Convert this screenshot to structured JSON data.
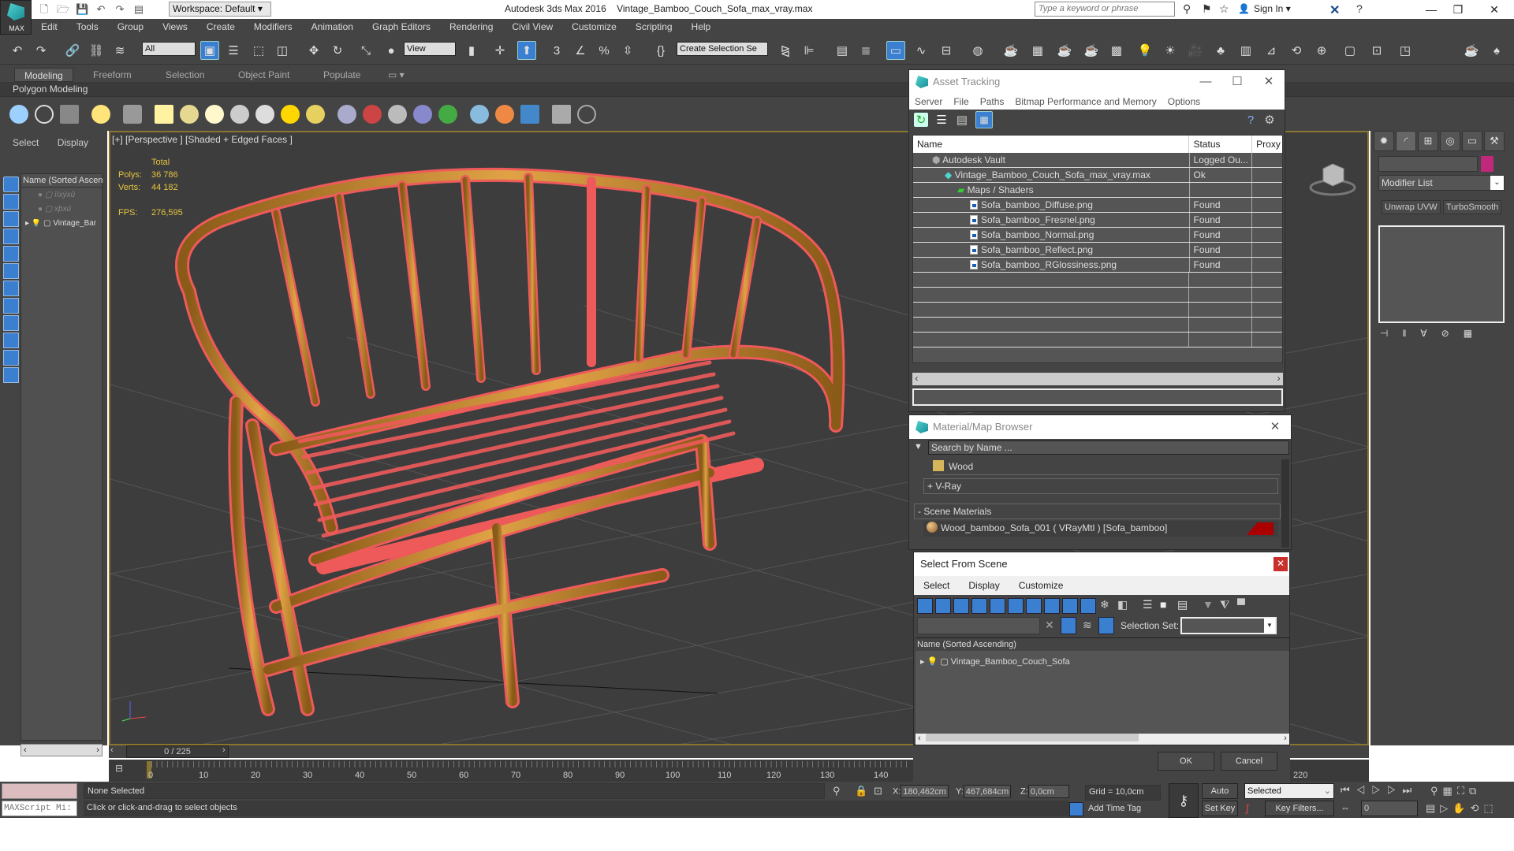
{
  "app": {
    "title": "Autodesk 3ds Max 2016",
    "filename": "Vintage_Bamboo_Couch_Sofa_max_vray.max",
    "logo_label": "MAX",
    "workspace": "Workspace: Default",
    "search_placeholder": "Type a keyword or phrase",
    "sign_in": "Sign In"
  },
  "menu": [
    "Edit",
    "Tools",
    "Group",
    "Views",
    "Create",
    "Modifiers",
    "Animation",
    "Graph Editors",
    "Rendering",
    "Civil View",
    "Customize",
    "Scripting",
    "Help"
  ],
  "toolbar": {
    "selection_filter": "All",
    "reference_coord": "View",
    "named_selection": "Create Selection Se"
  },
  "ribbon": {
    "tabs": [
      "Modeling",
      "Freeform",
      "Selection",
      "Object Paint",
      "Populate"
    ],
    "active_tab": "Modeling",
    "sub_label": "Polygon Modeling"
  },
  "scene_explorer": {
    "tabs": [
      "Select",
      "Display"
    ],
    "header": "Name (Sorted Ascending)",
    "rows": [
      "ïïxýxû",
      "xþxü",
      "Vintage_Bamboo_Couch_Sofa"
    ]
  },
  "viewport": {
    "label": "[+] [Perspective ] [Shaded + Edged Faces ]",
    "stats": {
      "total_label": "Total",
      "polys_label": "Polys:",
      "polys": "36 786",
      "verts_label": "Verts:",
      "verts": "44 182",
      "fps_label": "FPS:",
      "fps": "276,595"
    },
    "wire_color": "#ee5a5a",
    "object_color": "#c98a2e"
  },
  "command_panel": {
    "modifier_list": "Modifier List",
    "buttons": [
      "Unwrap UVW",
      "TurboSmooth"
    ],
    "object_color": "#c0287c"
  },
  "asset_tracking": {
    "title": "Asset Tracking",
    "menu": [
      "Server",
      "File",
      "Paths",
      "Bitmap Performance and Memory",
      "Options"
    ],
    "columns": [
      "Name",
      "Status",
      "Proxy S"
    ],
    "rows": [
      {
        "name": "Autodesk Vault",
        "status": "Logged Ou...",
        "indent": 1,
        "icon": "vault"
      },
      {
        "name": "Vintage_Bamboo_Couch_Sofa_max_vray.max",
        "status": "Ok",
        "indent": 2,
        "icon": "max"
      },
      {
        "name": "Maps / Shaders",
        "status": "",
        "indent": 3,
        "icon": "maps"
      },
      {
        "name": "Sofa_bamboo_Diffuse.png",
        "status": "Found",
        "indent": 4,
        "icon": "file"
      },
      {
        "name": "Sofa_bamboo_Fresnel.png",
        "status": "Found",
        "indent": 4,
        "icon": "file"
      },
      {
        "name": "Sofa_bamboo_Normal.png",
        "status": "Found",
        "indent": 4,
        "icon": "file"
      },
      {
        "name": "Sofa_bamboo_Reflect.png",
        "status": "Found",
        "indent": 4,
        "icon": "file"
      },
      {
        "name": "Sofa_bamboo_RGlossiness.png",
        "status": "Found",
        "indent": 4,
        "icon": "file"
      }
    ]
  },
  "material_browser": {
    "title": "Material/Map Browser",
    "search_placeholder": "Search by Name ...",
    "wood_item": "Wood",
    "vray_group": "+ V-Ray",
    "scene_group": "- Scene Materials",
    "scene_material": "Wood_bamboo_Sofa_001 ( VRayMtl ) [Sofa_bamboo]"
  },
  "select_from_scene": {
    "title": "Select From Scene",
    "menu": [
      "Select",
      "Display",
      "Customize"
    ],
    "selection_set_label": "Selection Set:",
    "header": "Name (Sorted Ascending)",
    "rows": [
      "Vintage_Bamboo_Couch_Sofa"
    ],
    "ok": "OK",
    "cancel": "Cancel"
  },
  "timeline": {
    "frame": "0 / 225",
    "ticks": [
      "0",
      "10",
      "20",
      "30",
      "40",
      "50",
      "60",
      "70",
      "80",
      "90",
      "100",
      "110",
      "120",
      "130",
      "140",
      "220"
    ]
  },
  "status": {
    "selection": "None Selected",
    "prompt": "Click or click-and-drag to select objects",
    "maxscript": "MAXScript Mi:",
    "x_label": "X:",
    "x": "180,462cm",
    "y_label": "Y:",
    "y": "467,684cm",
    "z_label": "Z:",
    "z": "0,0cm",
    "grid": "Grid = 10,0cm",
    "add_time_tag": "Add Time Tag",
    "auto_key": "Auto Key",
    "set_key": "Set Key",
    "key_mode": "Selected",
    "key_filters": "Key Filters...",
    "current_frame": "0"
  }
}
